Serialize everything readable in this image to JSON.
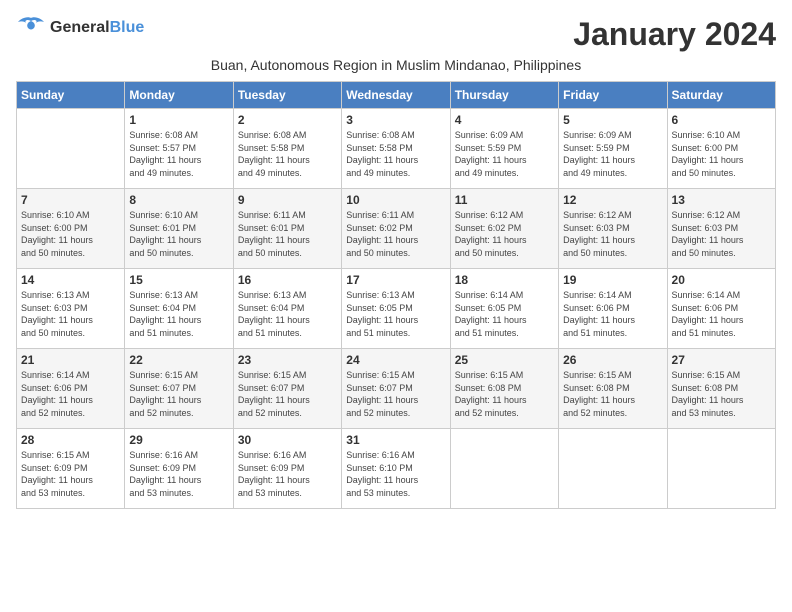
{
  "logo": {
    "line1": "General",
    "line2": "Blue"
  },
  "title": "January 2024",
  "subtitle": "Buan, Autonomous Region in Muslim Mindanao, Philippines",
  "weekdays": [
    "Sunday",
    "Monday",
    "Tuesday",
    "Wednesday",
    "Thursday",
    "Friday",
    "Saturday"
  ],
  "weeks": [
    [
      {
        "day": "",
        "info": ""
      },
      {
        "day": "1",
        "info": "Sunrise: 6:08 AM\nSunset: 5:57 PM\nDaylight: 11 hours\nand 49 minutes."
      },
      {
        "day": "2",
        "info": "Sunrise: 6:08 AM\nSunset: 5:58 PM\nDaylight: 11 hours\nand 49 minutes."
      },
      {
        "day": "3",
        "info": "Sunrise: 6:08 AM\nSunset: 5:58 PM\nDaylight: 11 hours\nand 49 minutes."
      },
      {
        "day": "4",
        "info": "Sunrise: 6:09 AM\nSunset: 5:59 PM\nDaylight: 11 hours\nand 49 minutes."
      },
      {
        "day": "5",
        "info": "Sunrise: 6:09 AM\nSunset: 5:59 PM\nDaylight: 11 hours\nand 49 minutes."
      },
      {
        "day": "6",
        "info": "Sunrise: 6:10 AM\nSunset: 6:00 PM\nDaylight: 11 hours\nand 50 minutes."
      }
    ],
    [
      {
        "day": "7",
        "info": "Sunrise: 6:10 AM\nSunset: 6:00 PM\nDaylight: 11 hours\nand 50 minutes."
      },
      {
        "day": "8",
        "info": "Sunrise: 6:10 AM\nSunset: 6:01 PM\nDaylight: 11 hours\nand 50 minutes."
      },
      {
        "day": "9",
        "info": "Sunrise: 6:11 AM\nSunset: 6:01 PM\nDaylight: 11 hours\nand 50 minutes."
      },
      {
        "day": "10",
        "info": "Sunrise: 6:11 AM\nSunset: 6:02 PM\nDaylight: 11 hours\nand 50 minutes."
      },
      {
        "day": "11",
        "info": "Sunrise: 6:12 AM\nSunset: 6:02 PM\nDaylight: 11 hours\nand 50 minutes."
      },
      {
        "day": "12",
        "info": "Sunrise: 6:12 AM\nSunset: 6:03 PM\nDaylight: 11 hours\nand 50 minutes."
      },
      {
        "day": "13",
        "info": "Sunrise: 6:12 AM\nSunset: 6:03 PM\nDaylight: 11 hours\nand 50 minutes."
      }
    ],
    [
      {
        "day": "14",
        "info": "Sunrise: 6:13 AM\nSunset: 6:03 PM\nDaylight: 11 hours\nand 50 minutes."
      },
      {
        "day": "15",
        "info": "Sunrise: 6:13 AM\nSunset: 6:04 PM\nDaylight: 11 hours\nand 51 minutes."
      },
      {
        "day": "16",
        "info": "Sunrise: 6:13 AM\nSunset: 6:04 PM\nDaylight: 11 hours\nand 51 minutes."
      },
      {
        "day": "17",
        "info": "Sunrise: 6:13 AM\nSunset: 6:05 PM\nDaylight: 11 hours\nand 51 minutes."
      },
      {
        "day": "18",
        "info": "Sunrise: 6:14 AM\nSunset: 6:05 PM\nDaylight: 11 hours\nand 51 minutes."
      },
      {
        "day": "19",
        "info": "Sunrise: 6:14 AM\nSunset: 6:06 PM\nDaylight: 11 hours\nand 51 minutes."
      },
      {
        "day": "20",
        "info": "Sunrise: 6:14 AM\nSunset: 6:06 PM\nDaylight: 11 hours\nand 51 minutes."
      }
    ],
    [
      {
        "day": "21",
        "info": "Sunrise: 6:14 AM\nSunset: 6:06 PM\nDaylight: 11 hours\nand 52 minutes."
      },
      {
        "day": "22",
        "info": "Sunrise: 6:15 AM\nSunset: 6:07 PM\nDaylight: 11 hours\nand 52 minutes."
      },
      {
        "day": "23",
        "info": "Sunrise: 6:15 AM\nSunset: 6:07 PM\nDaylight: 11 hours\nand 52 minutes."
      },
      {
        "day": "24",
        "info": "Sunrise: 6:15 AM\nSunset: 6:07 PM\nDaylight: 11 hours\nand 52 minutes."
      },
      {
        "day": "25",
        "info": "Sunrise: 6:15 AM\nSunset: 6:08 PM\nDaylight: 11 hours\nand 52 minutes."
      },
      {
        "day": "26",
        "info": "Sunrise: 6:15 AM\nSunset: 6:08 PM\nDaylight: 11 hours\nand 52 minutes."
      },
      {
        "day": "27",
        "info": "Sunrise: 6:15 AM\nSunset: 6:08 PM\nDaylight: 11 hours\nand 53 minutes."
      }
    ],
    [
      {
        "day": "28",
        "info": "Sunrise: 6:15 AM\nSunset: 6:09 PM\nDaylight: 11 hours\nand 53 minutes."
      },
      {
        "day": "29",
        "info": "Sunrise: 6:16 AM\nSunset: 6:09 PM\nDaylight: 11 hours\nand 53 minutes."
      },
      {
        "day": "30",
        "info": "Sunrise: 6:16 AM\nSunset: 6:09 PM\nDaylight: 11 hours\nand 53 minutes."
      },
      {
        "day": "31",
        "info": "Sunrise: 6:16 AM\nSunset: 6:10 PM\nDaylight: 11 hours\nand 53 minutes."
      },
      {
        "day": "",
        "info": ""
      },
      {
        "day": "",
        "info": ""
      },
      {
        "day": "",
        "info": ""
      }
    ]
  ]
}
